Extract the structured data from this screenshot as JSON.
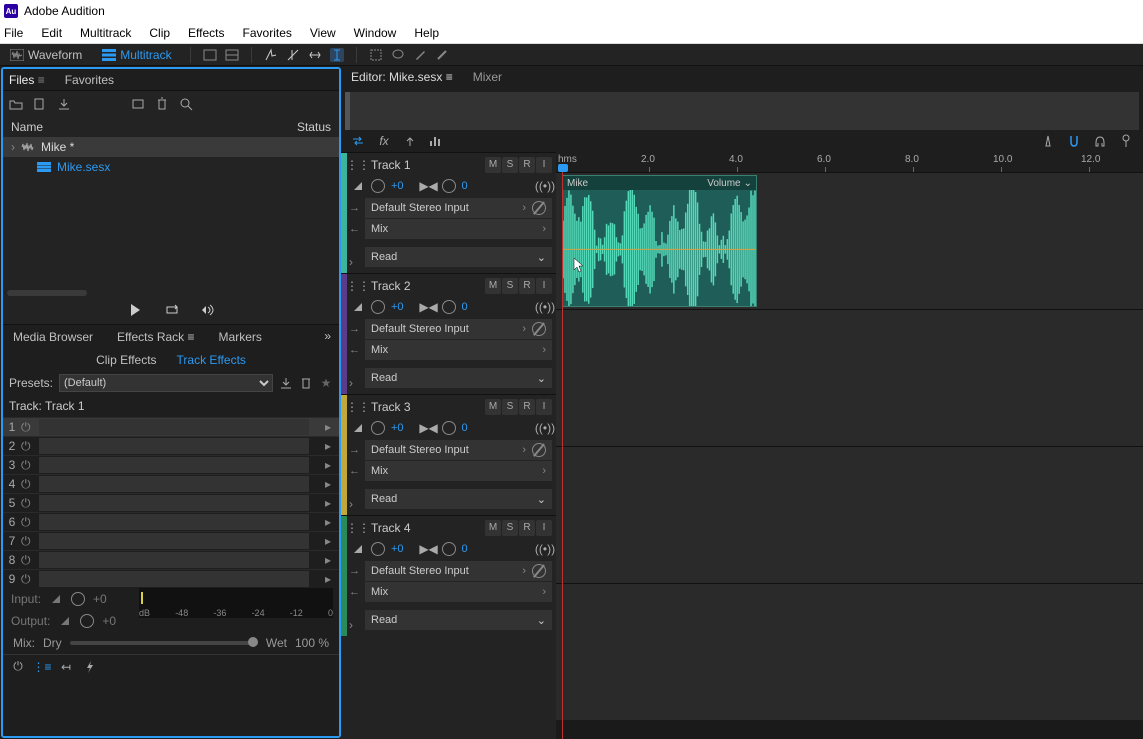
{
  "app": {
    "title": "Adobe Audition"
  },
  "menu": [
    "File",
    "Edit",
    "Multitrack",
    "Clip",
    "Effects",
    "Favorites",
    "View",
    "Window",
    "Help"
  ],
  "modes": {
    "waveform": "Waveform",
    "multitrack": "Multitrack"
  },
  "left": {
    "tabs": {
      "files": "Files",
      "favorites": "Favorites"
    },
    "columns": {
      "name": "Name",
      "status": "Status"
    },
    "files": [
      {
        "name": "Mike *",
        "link": false,
        "selected": true,
        "indent": 0
      },
      {
        "name": "Mike.sesx",
        "link": true,
        "selected": false,
        "indent": 1
      }
    ],
    "effects_tabs": {
      "media": "Media Browser",
      "rack": "Effects Rack",
      "markers": "Markers"
    },
    "sub_tabs": {
      "clip": "Clip Effects",
      "track": "Track Effects"
    },
    "presets_label": "Presets:",
    "preset_value": "(Default)",
    "track_label": "Track: Track 1",
    "slots": [
      "1",
      "2",
      "3",
      "4",
      "5",
      "6",
      "7",
      "8",
      "9"
    ],
    "io": {
      "input": "Input:",
      "output": "Output:",
      "val": "+0"
    },
    "meter_scale": [
      "dB",
      "-48",
      "-36",
      "-24",
      "-12",
      "0"
    ],
    "mix": {
      "label": "Mix:",
      "dry": "Dry",
      "wet": "Wet",
      "pct": "100 %"
    }
  },
  "editor": {
    "title": "Editor: Mike.sesx",
    "mixer": "Mixer",
    "ruler_unit": "hms",
    "ticks": [
      "2.0",
      "4.0",
      "6.0",
      "8.0",
      "10.0",
      "12.0"
    ],
    "tracks": [
      {
        "name": "Track 1",
        "color": "#3cb49b",
        "vol": "+0",
        "pan": "0",
        "input": "Default Stereo Input",
        "output": "Mix",
        "auto": "Read"
      },
      {
        "name": "Track 2",
        "color": "#5a3c8a",
        "vol": "+0",
        "pan": "0",
        "input": "Default Stereo Input",
        "output": "Mix",
        "auto": "Read"
      },
      {
        "name": "Track 3",
        "color": "#c2a838",
        "vol": "+0",
        "pan": "0",
        "input": "Default Stereo Input",
        "output": "Mix",
        "auto": "Read"
      },
      {
        "name": "Track 4",
        "color": "#2b8a5a",
        "vol": "+0",
        "pan": "0",
        "input": "Default Stereo Input",
        "output": "Mix",
        "auto": "Read"
      }
    ],
    "msr": {
      "m": "M",
      "s": "S",
      "r": "R",
      "i": "I"
    },
    "clip": {
      "name": "Mike",
      "vol_label": "Volume"
    }
  }
}
